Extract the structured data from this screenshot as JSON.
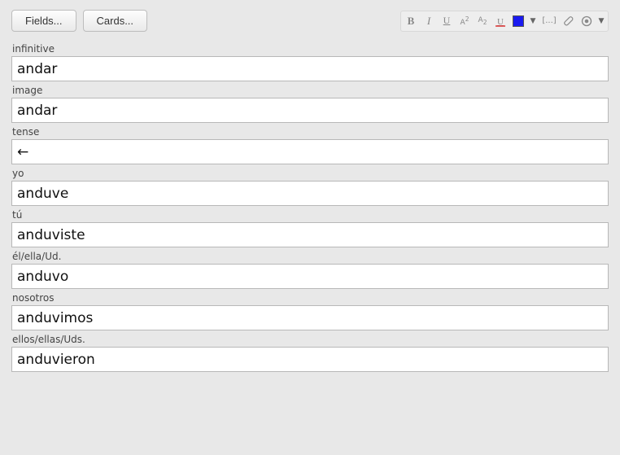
{
  "buttons": {
    "fields": "Fields...",
    "cards": "Cards..."
  },
  "toolbar": {
    "bold": "B",
    "italic": "I",
    "underline": "U",
    "superscript": "A²",
    "subscript": "A₂",
    "eraser": "U",
    "color": "#1a1af0",
    "more": "▾",
    "cloze": "[...]",
    "attach": "",
    "record": "",
    "etc": ""
  },
  "fields": [
    {
      "label": "infinitive",
      "value": "andar"
    },
    {
      "label": "image",
      "value": "andar"
    },
    {
      "label": "tense",
      "value": "←"
    },
    {
      "label": "yo",
      "value": "anduve"
    },
    {
      "label": "tú",
      "value": "anduviste"
    },
    {
      "label": "él/ella/Ud.",
      "value": "anduvo"
    },
    {
      "label": "nosotros",
      "value": "anduvimos"
    },
    {
      "label": "ellos/ellas/Uds.",
      "value": "anduvieron"
    }
  ]
}
